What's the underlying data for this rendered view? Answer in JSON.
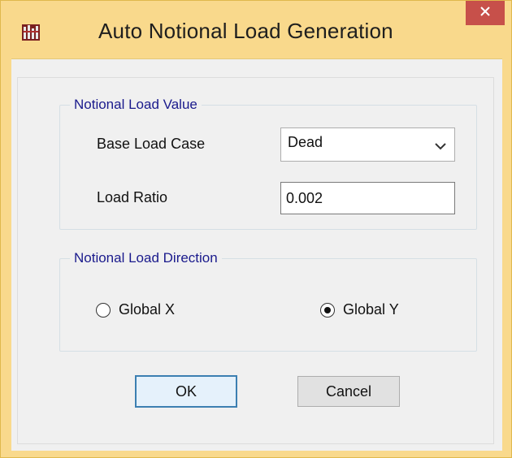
{
  "window": {
    "title": "Auto Notional Load Generation",
    "close_glyph": "×"
  },
  "notional_load_value": {
    "legend": "Notional Load Value",
    "base_load_case_label": "Base Load Case",
    "base_load_case_value": "Dead",
    "load_ratio_label": "Load Ratio",
    "load_ratio_value": "0.002"
  },
  "notional_load_direction": {
    "legend": "Notional Load Direction",
    "options": [
      {
        "label": "Global X",
        "selected": false
      },
      {
        "label": "Global Y",
        "selected": true
      }
    ]
  },
  "buttons": {
    "ok_label": "OK",
    "cancel_label": "Cancel"
  },
  "colors": {
    "title_bar": "#f9d98c",
    "close_button": "#c7504a",
    "legend_text": "#1a1a8c",
    "default_button_border": "#3c7fb1"
  },
  "icons": {
    "app": "app-icon",
    "close": "close-icon",
    "dropdown": "chevron-down-icon"
  }
}
